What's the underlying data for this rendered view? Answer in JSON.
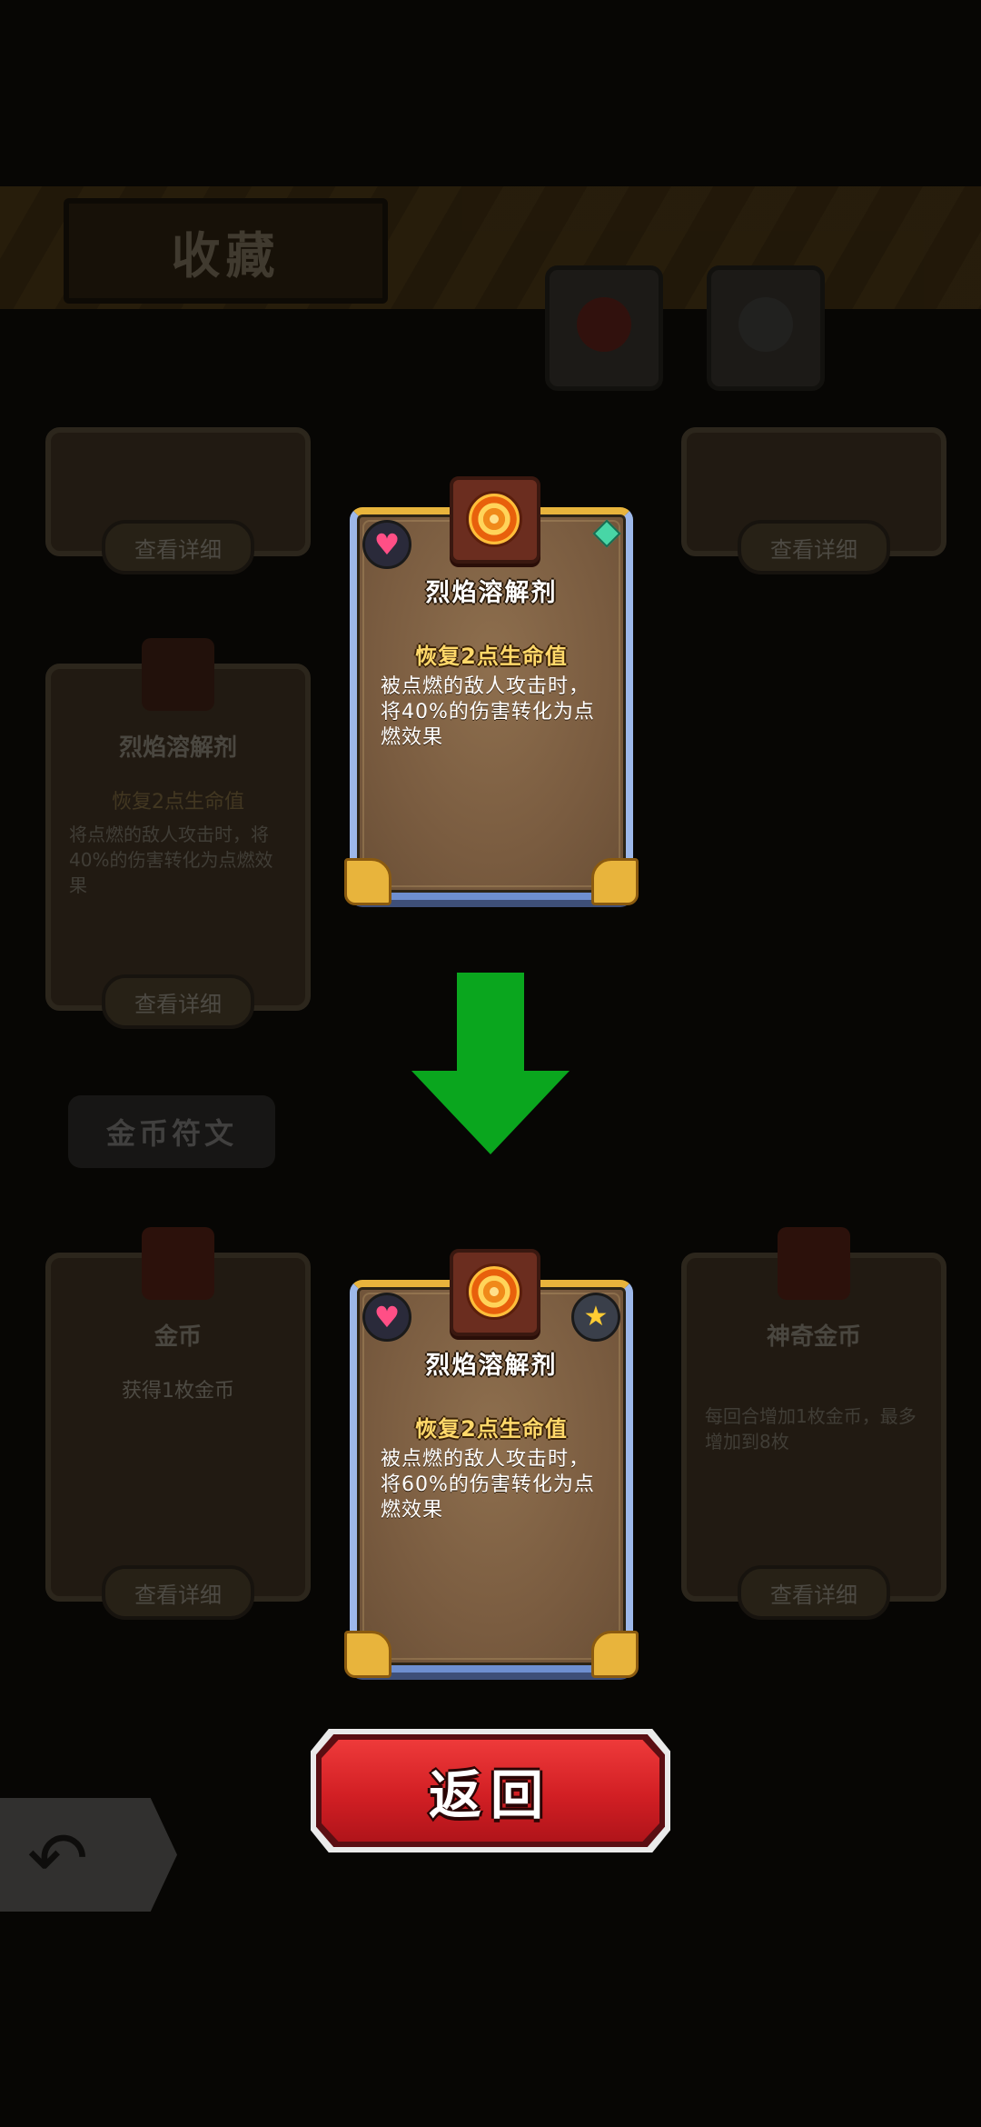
{
  "background": {
    "page_title": "收藏",
    "section_label": "金币符文",
    "detail_button_label": "查看详细",
    "cards": [
      {
        "name": "烈焰溶解剂",
        "line1": "恢复2点生命值",
        "line2": "将点燃的敌人攻击时，将40%的伤害转化为点燃效果"
      },
      {
        "name": "金币",
        "line1": "获得1枚金币",
        "line2": ""
      },
      {
        "name": "神奇金币",
        "line1": "",
        "line2": "每回合增加1枚金币，最多增加到8枚"
      }
    ]
  },
  "upgrade_before": {
    "title": "烈焰溶解剂",
    "effect": "恢复2点生命值",
    "description": "被点燃的敌人攻击时，将40%的伤害转化为点燃效果",
    "badge_left_icon": "heart-icon",
    "rune_icon": "fire-rune-icon"
  },
  "upgrade_after": {
    "title": "烈焰溶解剂",
    "effect": "恢复2点生命值",
    "description": "被点燃的敌人攻击时，将60%的伤害转化为点燃效果",
    "badge_left_icon": "heart-icon",
    "badge_right_icon": "star-icon",
    "rune_icon": "fire-rune-icon"
  },
  "arrow_color": "#0aa61e",
  "return_button": {
    "label": "返回",
    "color": "#d21f24"
  }
}
